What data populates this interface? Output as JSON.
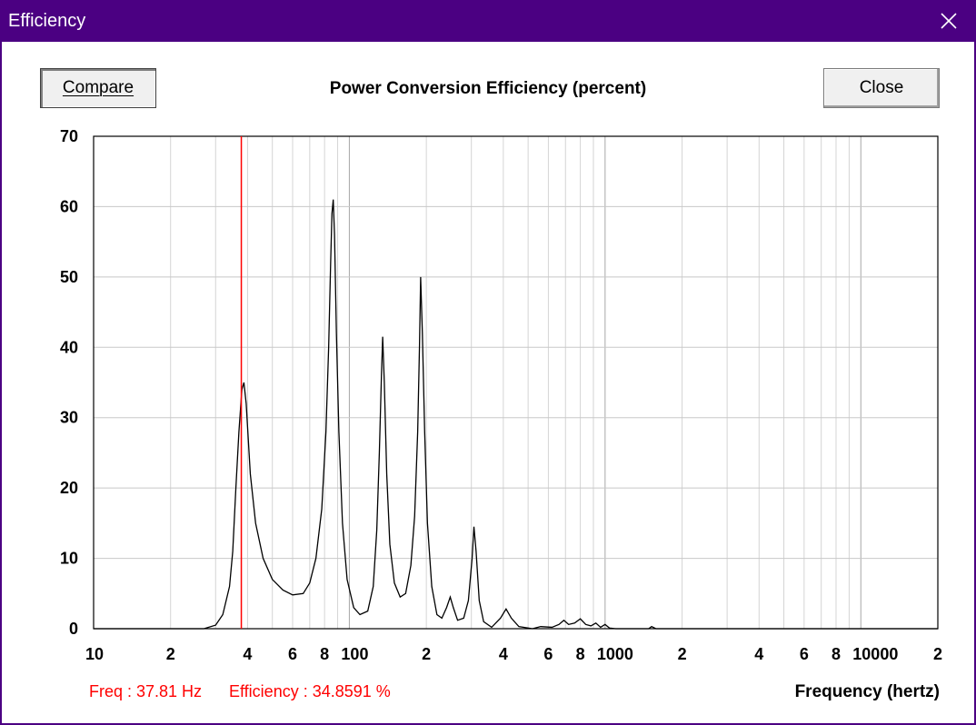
{
  "window": {
    "title": "Efficiency"
  },
  "toolbar": {
    "compare_label": "Compare",
    "close_label": "Close"
  },
  "chart_data": {
    "type": "line",
    "title": "Power Conversion Efficiency (percent)",
    "xlabel": "Frequency (hertz)",
    "ylabel": "",
    "xscale": "log",
    "xlim": [
      10,
      20000
    ],
    "ylim": [
      0,
      70
    ],
    "grid": true,
    "y_ticks": [
      0,
      10,
      20,
      30,
      40,
      50,
      60,
      70
    ],
    "x_tick_labels": [
      {
        "x": 10,
        "label": "10"
      },
      {
        "x": 20,
        "label": "2"
      },
      {
        "x": 40,
        "label": "4"
      },
      {
        "x": 60,
        "label": "6"
      },
      {
        "x": 80,
        "label": "8"
      },
      {
        "x": 100,
        "label": "100"
      },
      {
        "x": 200,
        "label": "2"
      },
      {
        "x": 400,
        "label": "4"
      },
      {
        "x": 600,
        "label": "6"
      },
      {
        "x": 800,
        "label": "8"
      },
      {
        "x": 1000,
        "label": "1000"
      },
      {
        "x": 2000,
        "label": "2"
      },
      {
        "x": 4000,
        "label": "4"
      },
      {
        "x": 6000,
        "label": "6"
      },
      {
        "x": 8000,
        "label": "8"
      },
      {
        "x": 10000,
        "label": "10000"
      },
      {
        "x": 20000,
        "label": "2"
      }
    ],
    "cursor_x": 37.81,
    "series": [
      {
        "line_color": "#000000",
        "points": [
          [
            10,
            0
          ],
          [
            27,
            0
          ],
          [
            30,
            0.5
          ],
          [
            32,
            2
          ],
          [
            34,
            6
          ],
          [
            35,
            11
          ],
          [
            36,
            20
          ],
          [
            37,
            28
          ],
          [
            38,
            34
          ],
          [
            38.7,
            35
          ],
          [
            39.5,
            32
          ],
          [
            41,
            22
          ],
          [
            43,
            15
          ],
          [
            46,
            10
          ],
          [
            50,
            7
          ],
          [
            55,
            5.5
          ],
          [
            60,
            4.8
          ],
          [
            66,
            5
          ],
          [
            70,
            6.5
          ],
          [
            74,
            10
          ],
          [
            78,
            17
          ],
          [
            81,
            28
          ],
          [
            83,
            40
          ],
          [
            84.5,
            52
          ],
          [
            85.5,
            59
          ],
          [
            86.5,
            61
          ],
          [
            87.5,
            56
          ],
          [
            89,
            42
          ],
          [
            91,
            28
          ],
          [
            94,
            15
          ],
          [
            98,
            7
          ],
          [
            104,
            3
          ],
          [
            110,
            2
          ],
          [
            118,
            2.5
          ],
          [
            124,
            6
          ],
          [
            128,
            14
          ],
          [
            131,
            25
          ],
          [
            133.5,
            36
          ],
          [
            135,
            41.5
          ],
          [
            137,
            35
          ],
          [
            140,
            22
          ],
          [
            144,
            12
          ],
          [
            150,
            6.5
          ],
          [
            158,
            4.5
          ],
          [
            166,
            5
          ],
          [
            174,
            9
          ],
          [
            180,
            16
          ],
          [
            185,
            28
          ],
          [
            188,
            40
          ],
          [
            190,
            50
          ],
          [
            193,
            42
          ],
          [
            197,
            28
          ],
          [
            202,
            15
          ],
          [
            210,
            6
          ],
          [
            220,
            2
          ],
          [
            230,
            1.5
          ],
          [
            240,
            3
          ],
          [
            248,
            4.5
          ],
          [
            255,
            3
          ],
          [
            265,
            1.2
          ],
          [
            280,
            1.5
          ],
          [
            292,
            4
          ],
          [
            302,
            10
          ],
          [
            307,
            14.5
          ],
          [
            313,
            11
          ],
          [
            322,
            4
          ],
          [
            335,
            1
          ],
          [
            360,
            0.2
          ],
          [
            390,
            1.5
          ],
          [
            410,
            2.8
          ],
          [
            430,
            1.5
          ],
          [
            460,
            0.3
          ],
          [
            520,
            0
          ],
          [
            560,
            0.3
          ],
          [
            620,
            0.2
          ],
          [
            660,
            0.6
          ],
          [
            690,
            1.2
          ],
          [
            720,
            0.6
          ],
          [
            760,
            0.8
          ],
          [
            800,
            1.4
          ],
          [
            840,
            0.6
          ],
          [
            880,
            0.4
          ],
          [
            920,
            0.8
          ],
          [
            960,
            0.2
          ],
          [
            1000,
            0.6
          ],
          [
            1040,
            0.1
          ],
          [
            1100,
            0
          ],
          [
            1480,
            0
          ],
          [
            1520,
            0.3
          ],
          [
            1580,
            0
          ],
          [
            20000,
            0
          ]
        ]
      }
    ]
  },
  "status": {
    "freq": "Freq : 37.81 Hz",
    "efficiency": "Efficiency : 34.8591 %"
  },
  "colors": {
    "titlebar": "#4b0082",
    "cursor": "#ff0000",
    "grid": "#c8c8c8"
  }
}
